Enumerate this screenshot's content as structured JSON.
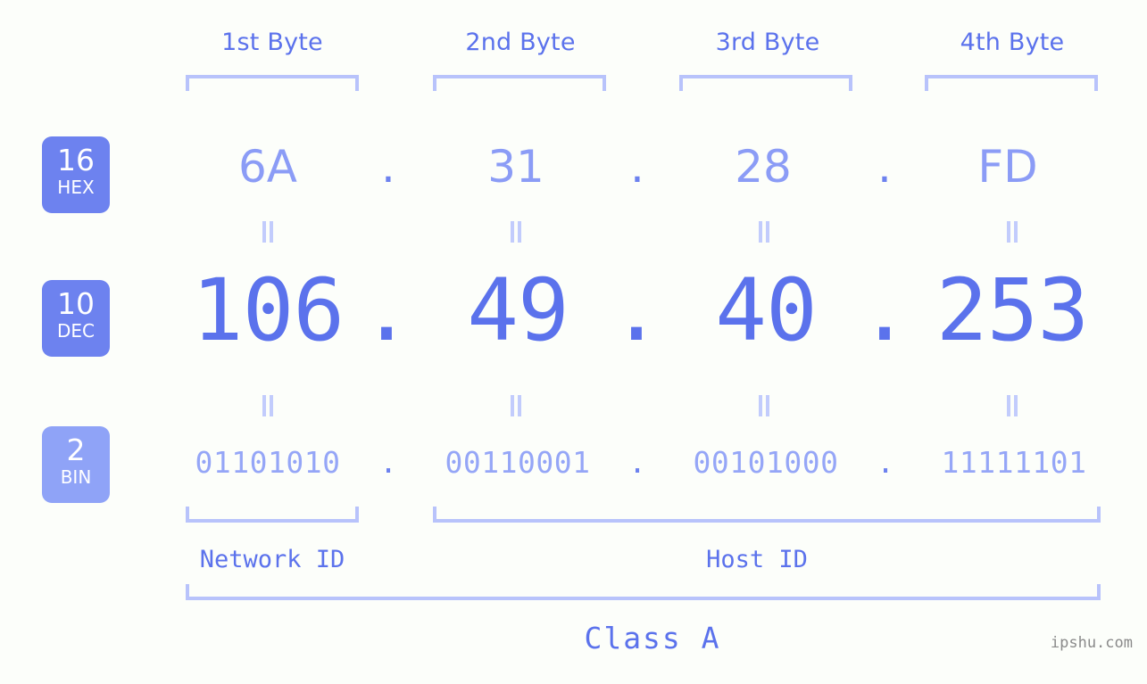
{
  "background_color": "#fcfefa",
  "accent_color": "#5b72ec",
  "accent_light": "#8b9cf6",
  "bracket_color": "#b8c3fb",
  "badge_color": "#6d82ef",
  "ip_address": "106.49.40.253",
  "byte_headers": [
    {
      "label": "1st Byte"
    },
    {
      "label": "2nd Byte"
    },
    {
      "label": "3rd Byte"
    },
    {
      "label": "4th Byte"
    }
  ],
  "radix_badges": [
    {
      "number": "16",
      "word": "HEX"
    },
    {
      "number": "10",
      "word": "DEC"
    },
    {
      "number": "2",
      "word": "BIN"
    }
  ],
  "rows": {
    "hex": {
      "values": [
        "6A",
        "31",
        "28",
        "FD"
      ],
      "separator": "."
    },
    "dec": {
      "values": [
        "106",
        "49",
        "40",
        "253"
      ],
      "separator": "."
    },
    "bin": {
      "values": [
        "01101010",
        "00110001",
        "00101000",
        "11111101"
      ],
      "separator": "."
    }
  },
  "equals_marks": {
    "symbol": "||",
    "count_per_row": 4
  },
  "sections": [
    {
      "label": "Network ID"
    },
    {
      "label": "Host ID"
    }
  ],
  "class_label": "Class A",
  "watermark": "ipshu.com"
}
